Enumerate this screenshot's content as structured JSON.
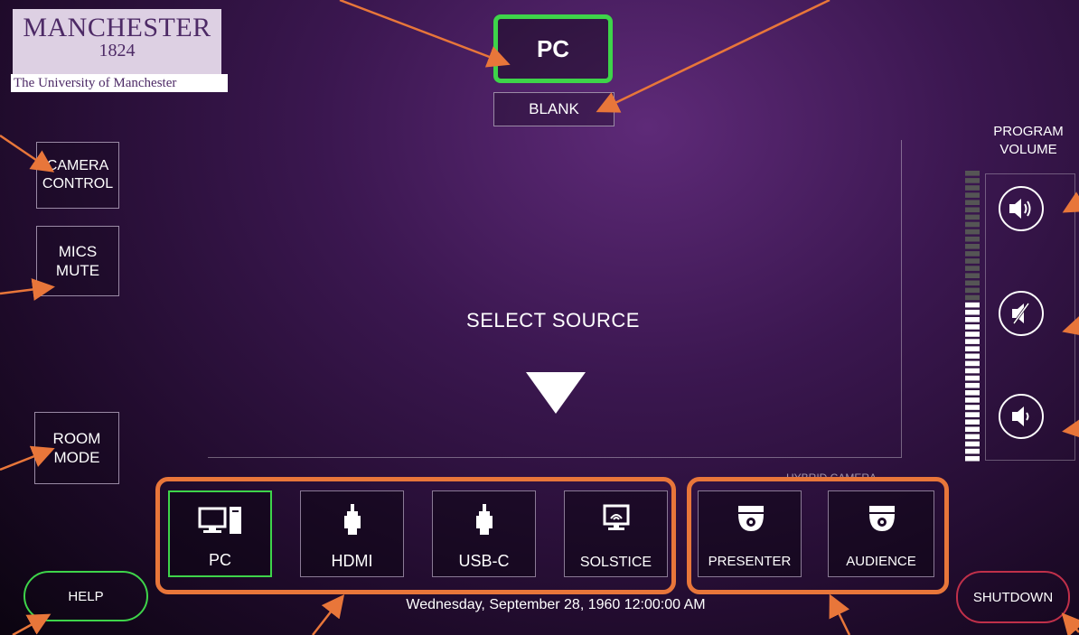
{
  "logo": {
    "name": "MANCHESTER",
    "year": "1824",
    "subtitle": "The University of Manchester"
  },
  "top": {
    "active_source": "PC",
    "blank_label": "BLANK"
  },
  "left": {
    "camera_control": "CAMERA CONTROL",
    "mics_mute": "MICS MUTE",
    "room_mode": "ROOM MODE"
  },
  "center": {
    "prompt": "SELECT SOURCE"
  },
  "volume": {
    "title": "PROGRAM VOLUME",
    "level": 0.55
  },
  "sources": [
    {
      "label": "PC",
      "icon": "desktop-pc-icon",
      "selected": true
    },
    {
      "label": "HDMI",
      "icon": "hdmi-plug-icon",
      "selected": false
    },
    {
      "label": "USB-C",
      "icon": "usbc-plug-icon",
      "selected": false
    },
    {
      "label": "SOLSTICE",
      "icon": "wireless-display-icon",
      "selected": false
    }
  ],
  "hybrid_camera": {
    "title": "HYBRID CAMERA",
    "buttons": [
      {
        "label": "PRESENTER"
      },
      {
        "label": "AUDIENCE"
      }
    ]
  },
  "footer": {
    "help": "HELP",
    "datetime": "Wednesday, September 28, 1960 12:00:00 AM",
    "shutdown": "SHUTDOWN"
  },
  "colors": {
    "accent_green": "#3ed44a",
    "annotation_orange": "#e8763a",
    "shutdown_ring": "#c0304a"
  }
}
